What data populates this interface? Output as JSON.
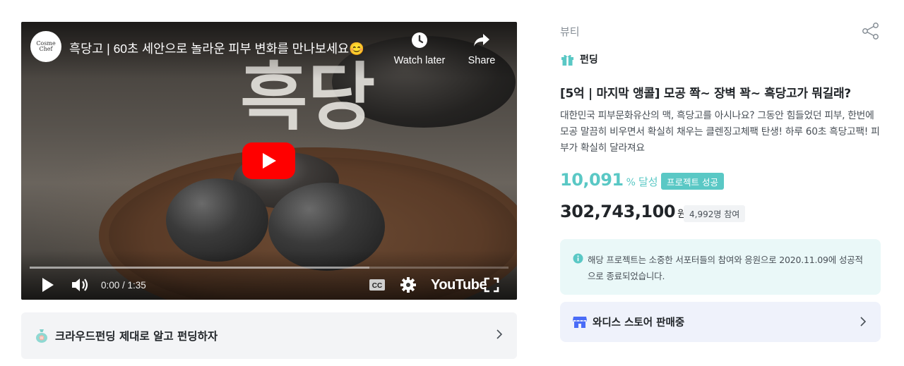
{
  "video": {
    "channel_logo_text": "Cosme Chef",
    "title": "흑당고 | 60초 세안으로 놀라운 피부 변화를 만나보세요😊",
    "overlay_text": "흑당",
    "watch_later_label": "Watch later",
    "share_label": "Share",
    "time_display": "0:00 / 1:35",
    "youtube_logo": "YouTube",
    "progress_loaded": 0.71,
    "icons": [
      "play-icon",
      "volume-icon",
      "captions-icon",
      "settings-icon",
      "fullscreen-icon",
      "clock-icon",
      "share-arrow-icon"
    ]
  },
  "guide": {
    "label": "크라우드펀딩 제대로 알고 펀딩하자"
  },
  "project": {
    "category": "뷰티",
    "tag": "펀딩",
    "title": "[5억 | 마지막 앵콜] 모공 쫙~ 장벽 꽉~ 흑당고가 뭐길래?",
    "description": "대한민국 피부문화유산의 맥, 흑당고를 아시나요? 그동안 힘들었던 피부, 한번에 모공 말끔히 비우면서 확실히 채우는 클렌징고체팩 탄생! 하루 60초 흑당고팩! 피부가 확실히 달라져요",
    "achievement_rate": "10,091",
    "rate_percent": "%",
    "rate_unit": "달성",
    "status_badge": "프로젝트 성공",
    "amount": "302,743,100",
    "currency": "원",
    "participants": "4,992명 참여"
  },
  "notice": {
    "text": "해당 프로젝트는 소중한 서포터들의 참여와 응원으로 2020.11.09에 성공적으로 종료되었습니다."
  },
  "store": {
    "label": "와디스 스토어 판매중"
  },
  "colors": {
    "accent": "#5ac8c5",
    "youtube_red": "#ff0000",
    "notice_bg": "#eaf8f8",
    "store_bg": "#eff2fb",
    "guide_bg": "#f3f4f6"
  }
}
